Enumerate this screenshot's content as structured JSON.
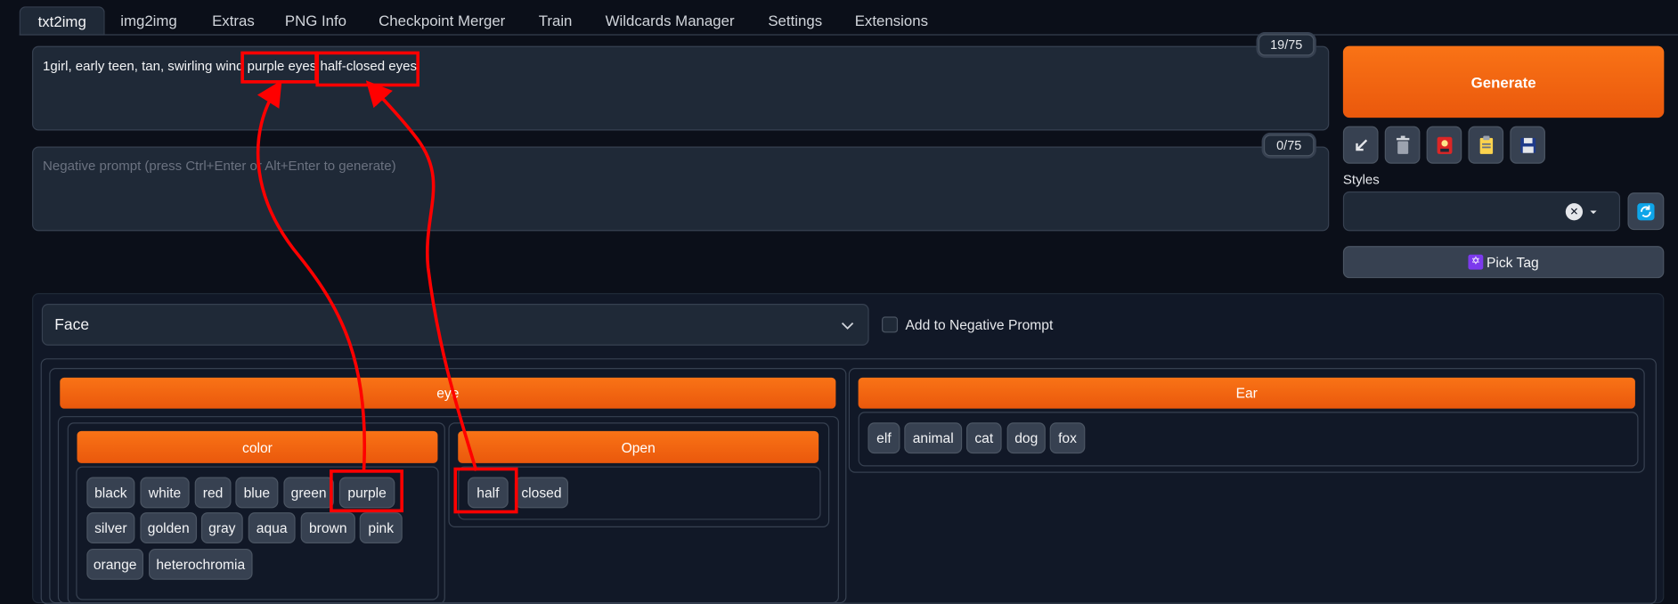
{
  "tabs": [
    "txt2img",
    "img2img",
    "Extras",
    "PNG Info",
    "Checkpoint Merger",
    "Train",
    "Wildcards Manager",
    "Settings",
    "Extensions"
  ],
  "prompt": {
    "text_before": "1girl, early teen, tan, swirling wind",
    "tag_eyes": "purple eyes",
    "tag_closed": "half-closed eyes",
    "counter": "19/75"
  },
  "negative_prompt": {
    "placeholder": "Negative prompt (press Ctrl+Enter or Alt+Enter to generate)",
    "counter": "0/75"
  },
  "actions": {
    "generate_label": "Generate",
    "tool_icons": [
      "arrow-icon",
      "trash-icon",
      "card-icon",
      "clipboard-icon",
      "save-icon"
    ],
    "styles_label": "Styles",
    "styles_clear": "✕",
    "pick_tag_label": "Pick Tag"
  },
  "tag_picker": {
    "category_selected": "Face",
    "add_negative_label": "Add to Negative Prompt",
    "eye_title": "eye",
    "ear_title": "Ear",
    "color_title": "color",
    "open_title": "Open",
    "color_tags_row1": [
      "black",
      "white",
      "red",
      "blue",
      "green",
      "purple"
    ],
    "color_tags_row2": [
      "silver",
      "golden",
      "gray",
      "aqua",
      "brown",
      "pink"
    ],
    "color_tags_row3": [
      "orange",
      "heterochromia"
    ],
    "open_tags": [
      "half",
      "closed"
    ],
    "ear_tags": [
      "elf",
      "animal",
      "cat",
      "dog",
      "fox"
    ]
  },
  "colors": {
    "accent": "#f97316",
    "annotation": "#ff0000",
    "background": "#0b0f19"
  }
}
